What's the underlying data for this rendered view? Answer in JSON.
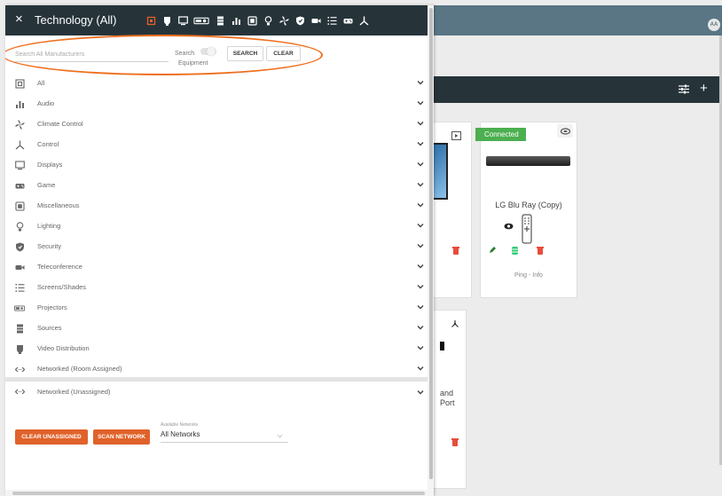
{
  "panel": {
    "title": "Technology (All)",
    "close": "×",
    "search": {
      "placeholder": "Search All Manufacturers",
      "value": ""
    },
    "toggle_label_1": "Search",
    "toggle_label_2": "Equipment",
    "search_button": "SEARCH",
    "clear_button": "CLEAR",
    "header_icons": [
      "projector-icon",
      "video-distribution-icon",
      "display-icon",
      "projectors-icon",
      "sources-icon",
      "audio-icon",
      "miscellaneous-icon",
      "lighting-icon",
      "climate-control-icon",
      "security-icon",
      "teleconference-icon",
      "screens-shades-icon",
      "game-icon",
      "control-icon"
    ],
    "categories": [
      {
        "label": "All",
        "icon": "all-icon"
      },
      {
        "label": "Audio",
        "icon": "audio-icon"
      },
      {
        "label": "Climate Control",
        "icon": "climate-control-icon"
      },
      {
        "label": "Control",
        "icon": "control-icon"
      },
      {
        "label": "Displays",
        "icon": "display-icon"
      },
      {
        "label": "Game",
        "icon": "game-icon"
      },
      {
        "label": "Miscellaneous",
        "icon": "miscellaneous-icon"
      },
      {
        "label": "Lighting",
        "icon": "lighting-icon"
      },
      {
        "label": "Security",
        "icon": "security-icon"
      },
      {
        "label": "Teleconference",
        "icon": "teleconference-icon"
      },
      {
        "label": "Screens/Shades",
        "icon": "screens-shades-icon"
      },
      {
        "label": "Projectors",
        "icon": "projectors-icon"
      },
      {
        "label": "Sources",
        "icon": "sources-icon"
      },
      {
        "label": "Video Distribution",
        "icon": "video-distribution-icon"
      },
      {
        "label": "Networked (Room Assigned)",
        "icon": "networked-icon"
      }
    ],
    "unassigned_label": "Networked (Unassigned)",
    "clear_unassigned": "CLEAR UNASSIGNED",
    "scan_network": "SCAN NETWORK",
    "networks_caption": "Available Networks",
    "networks_value": "All Networks"
  },
  "background": {
    "avatar": "AA",
    "card_title": "LG Blu Ray (Copy)",
    "card_status": "Connected",
    "card_info": "Ping - Info",
    "partial_text_1": "and",
    "partial_text_2": "Port"
  },
  "colors": {
    "header": "#26343a",
    "topbar": "#5a7584",
    "accent": "#e0622a",
    "connected": "#4caf50",
    "highlight": "#ee6f1f"
  }
}
